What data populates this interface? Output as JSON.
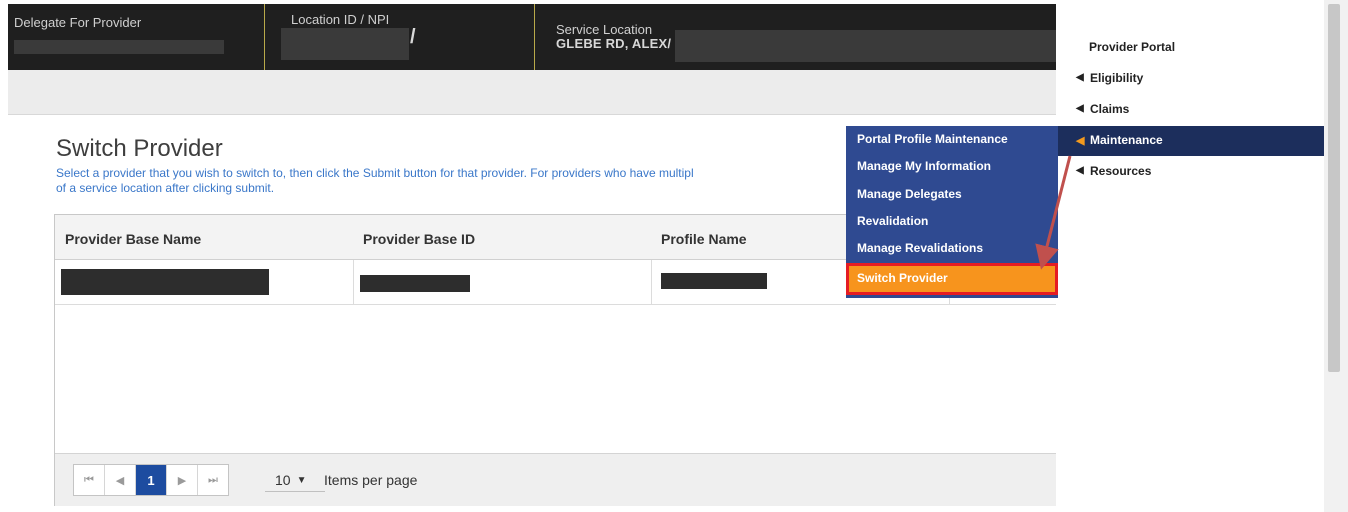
{
  "header": {
    "delegate_label": "Delegate For Provider",
    "location_label": "Location ID / NPI",
    "location_value_suffix": "/",
    "service_label": "Service Location",
    "service_value": "GLEBE RD, ALEX/"
  },
  "page": {
    "title": "Switch Provider",
    "description": "Select a provider that you wish to switch to, then click the Submit button for that provider. For providers who have multipl",
    "description_line2": "of a service location after clicking submit."
  },
  "grid": {
    "columns": [
      "Provider Base Name",
      "Provider Base ID",
      "Profile Name"
    ]
  },
  "pager": {
    "first_icon": "first-page-icon",
    "prev_icon": "prev-page-icon",
    "current_page": "1",
    "next_icon": "next-page-icon",
    "last_icon": "last-page-icon",
    "page_size": "10",
    "items_per_page_label": "Items per page"
  },
  "nav": {
    "title": "Provider Portal",
    "items": [
      {
        "label": "Eligibility"
      },
      {
        "label": "Claims"
      },
      {
        "label": "Maintenance"
      },
      {
        "label": "Resources"
      }
    ]
  },
  "submenu": {
    "items": [
      {
        "label": "Portal Profile Maintenance"
      },
      {
        "label": "Manage My Information"
      },
      {
        "label": "Manage Delegates"
      },
      {
        "label": "Revalidation"
      },
      {
        "label": "Manage Revalidations"
      },
      {
        "label": "Switch Provider"
      }
    ]
  },
  "colors": {
    "header_bg": "#1f1f1f",
    "nav_active_bg": "#1c2e5c",
    "submenu_bg": "#2f4a91",
    "highlight_bg": "#f7941d",
    "highlight_border": "#e51c23",
    "pager_active": "#1d4ca0",
    "description_text": "#3a77c9"
  }
}
